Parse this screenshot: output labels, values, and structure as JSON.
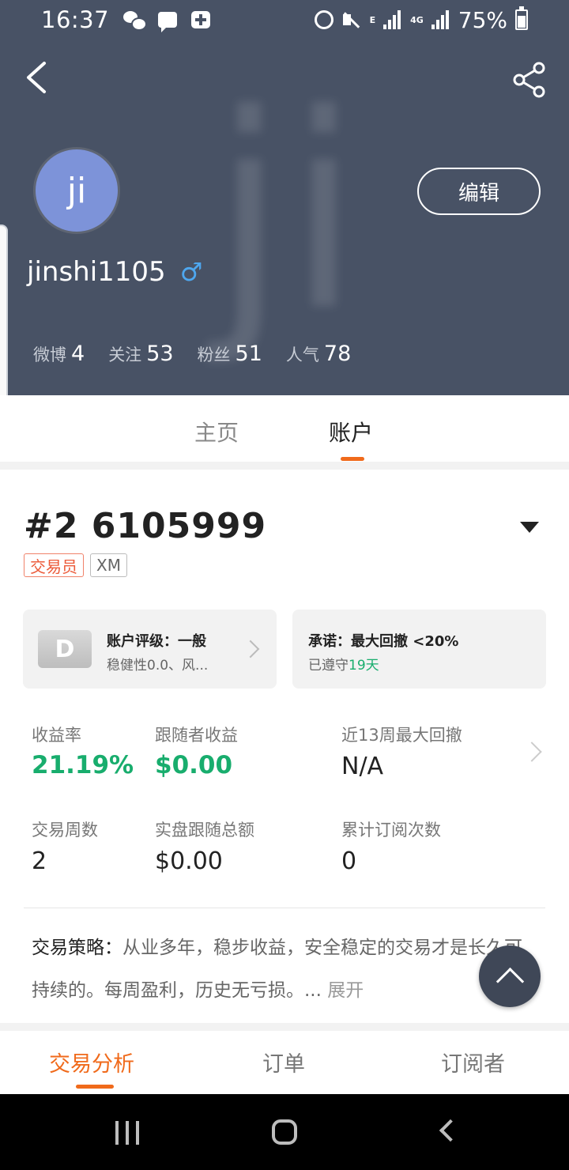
{
  "status_bar": {
    "time": "16:37",
    "net_a": "E",
    "net_b": "4G",
    "battery": "75%"
  },
  "profile": {
    "avatar_text": "ji",
    "watermark_text": "ji",
    "username": "jinshi1105",
    "gender_symbol": "♂",
    "edit_label": "编辑",
    "stats": [
      {
        "label": "微博",
        "value": "4"
      },
      {
        "label": "关注",
        "value": "53"
      },
      {
        "label": "粉丝",
        "value": "51"
      },
      {
        "label": "人气",
        "value": "78"
      }
    ]
  },
  "tabs": {
    "home": "主页",
    "account": "账户"
  },
  "account": {
    "title": "#2 6105999",
    "badge_trader": "交易员",
    "badge_broker": "XM",
    "rating_card": {
      "grade": "D",
      "title": "账户评级：一般",
      "subtitle": "稳健性0.0、风..."
    },
    "promise_card": {
      "title": "承诺：最大回撤 <20%",
      "subtitle_prefix": "已遵守",
      "days": "19天"
    },
    "metrics": [
      {
        "label": "收益率",
        "value": "21.19%"
      },
      {
        "label": "跟随者收益",
        "value": "$0.00"
      },
      {
        "label": "近13周最大回撤",
        "value": "N/A"
      },
      {
        "label": "交易周数",
        "value": "2"
      },
      {
        "label": "实盘跟随总额",
        "value": "$0.00"
      },
      {
        "label": "累计订阅次数",
        "value": "0"
      }
    ],
    "strategy": {
      "label": "交易策略：",
      "text": "从业多年，稳步收益，安全稳定的交易才是长久可持续的。每周盈利，历史无亏损。...",
      "expand": "展开"
    }
  },
  "bottom_tabs": {
    "analysis": "交易分析",
    "orders": "订单",
    "subscribers": "订阅者"
  },
  "colors": {
    "header_bg": "#485265",
    "accent_orange": "#f06a1b",
    "positive_green": "#18ad6d",
    "avatar_bg": "#7d93d9"
  }
}
